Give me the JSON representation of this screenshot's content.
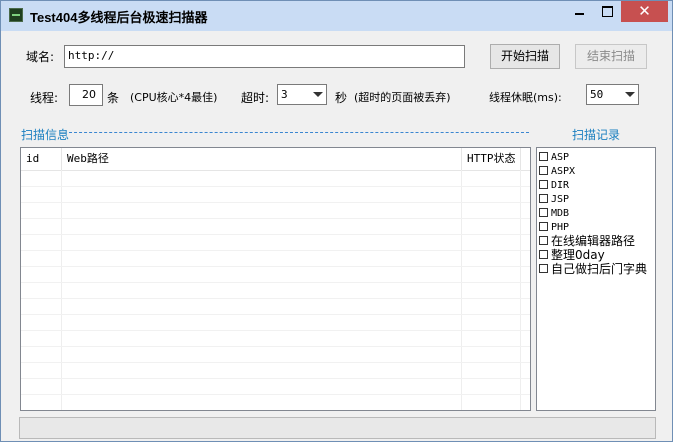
{
  "window": {
    "title": "Test404多线程后台极速扫描器",
    "close_glyph": "✕"
  },
  "domain": {
    "label": "域名:",
    "value": "http://"
  },
  "buttons": {
    "start": "开始扫描",
    "stop": "结束扫描"
  },
  "threads": {
    "label": "线程:",
    "value": "20",
    "unit": "条",
    "hint": "(CPU核心*4最佳)"
  },
  "timeout": {
    "label": "超时:",
    "value": "3",
    "unit": "秒",
    "hint": "(超时的页面被丢弃)"
  },
  "sleep": {
    "label": "线程休眠(ms):",
    "value": "50"
  },
  "scan_info": {
    "title": "扫描信息",
    "columns": [
      "id",
      "Web路径",
      "HTTP状态"
    ]
  },
  "records": {
    "title": "扫描记录",
    "items": [
      {
        "label": "ASP",
        "checked": false
      },
      {
        "label": "ASPX",
        "checked": false
      },
      {
        "label": "DIR",
        "checked": false
      },
      {
        "label": "JSP",
        "checked": false
      },
      {
        "label": "MDB",
        "checked": false
      },
      {
        "label": "PHP",
        "checked": false
      },
      {
        "label": "在线编辑器路径",
        "checked": false
      },
      {
        "label": "整理0day",
        "checked": false
      },
      {
        "label": "自己做扫后门字典",
        "checked": false
      }
    ]
  },
  "colors": {
    "section_title": "#1a7fc0",
    "close_button": "#c75050",
    "titlebar": "#c9dcf4"
  }
}
